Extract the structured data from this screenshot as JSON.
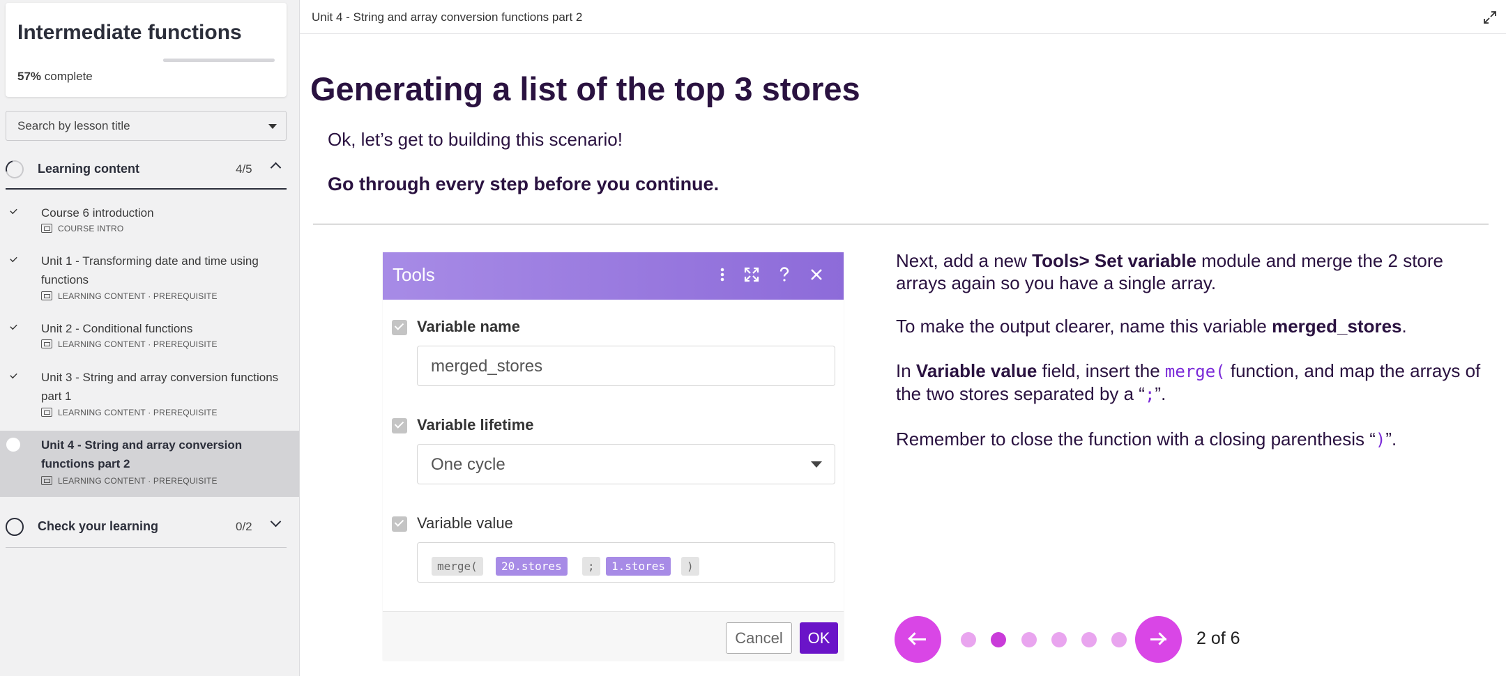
{
  "course": {
    "title": "Intermediate functions",
    "progress_percent": "57%",
    "progress_suffix": "complete",
    "progress_fraction": 0.57
  },
  "search": {
    "placeholder": "Search by lesson title"
  },
  "sections": [
    {
      "label": "Learning content",
      "count": "4/5",
      "state": "partial",
      "expanded": true
    },
    {
      "label": "Check your learning",
      "count": "0/2",
      "state": "empty",
      "expanded": false
    }
  ],
  "lessons": [
    {
      "title": "Course 6 introduction",
      "meta": "COURSE INTRO",
      "done": true
    },
    {
      "title": "Unit 1 - Transforming date and time using functions",
      "meta": "LEARNING CONTENT · PREREQUISITE",
      "done": true
    },
    {
      "title": "Unit 2 - Conditional functions",
      "meta": "LEARNING CONTENT · PREREQUISITE",
      "done": true
    },
    {
      "title": "Unit 3 - String and array conversion functions part 1",
      "meta": "LEARNING CONTENT · PREREQUISITE",
      "done": true
    },
    {
      "title": "Unit 4 - String and array conversion functions part 2",
      "meta": "LEARNING CONTENT · PREREQUISITE",
      "done": false,
      "active": true
    }
  ],
  "main": {
    "unit_title": "Unit 4 - String and array conversion functions part 2",
    "page_title": "Generating a list of the top 3 stores",
    "intro": "Ok, let’s get to building this scenario!",
    "intro_bold": "Go through every step before you continue."
  },
  "tools_module": {
    "title": "Tools",
    "header_icons": [
      "more-vertical-icon",
      "fullscreen-icon",
      "help-icon",
      "close-icon"
    ],
    "fields": [
      {
        "label": "Variable name",
        "value": "merged_stores"
      },
      {
        "label": "Variable lifetime",
        "value": "One cycle"
      },
      {
        "label": "Variable value"
      }
    ],
    "tokens": [
      "merge(",
      "20.stores",
      ";",
      "1.stores",
      ")"
    ],
    "cancel_label": "Cancel",
    "ok_label": "OK",
    "accent": "#a78be6",
    "ok_color": "#6a14c8"
  },
  "instructions": {
    "p1_a": "Next, add a new ",
    "p1_b": "Tools> Set variable",
    "p1_c": " module and merge the 2 store arrays again so you have a single array.",
    "p2_a": "To make the output clearer, name this variable ",
    "p2_b": "merged_stores",
    "p2_c": ".",
    "p3_a": "In ",
    "p3_b": "Variable value",
    "p3_c": " field, insert the ",
    "p3_code": "merge(",
    "p3_d": " function, and map the arrays of the two stores separated by a “",
    "p3_code2": ";",
    "p3_e": "”.",
    "p4_a": "Remember to close the function with a closing parenthesis “",
    "p4_code": ")",
    "p4_b": "”."
  },
  "pager": {
    "label": "2 of 6",
    "total": 6,
    "current": 2,
    "color": "#d946e6"
  }
}
